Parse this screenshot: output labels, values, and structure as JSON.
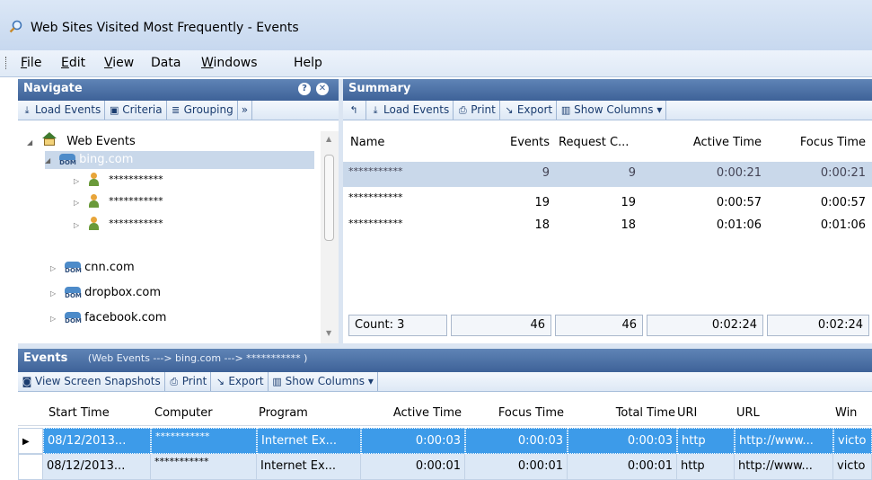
{
  "window": {
    "title": "Web Sites Visited Most Frequently - Events",
    "icon": "magnifier-icon"
  },
  "menu": [
    "File",
    "Edit",
    "View",
    "Data",
    "Windows",
    "Help"
  ],
  "navigate": {
    "title": "Navigate",
    "toolbar": [
      "Load Events",
      "Criteria",
      "Grouping",
      "»"
    ],
    "tree": {
      "root": "Web Events",
      "items": [
        {
          "label": "bing.com",
          "expanded": true,
          "children": [
            "***********",
            "***********",
            "***********"
          ]
        },
        {
          "label": "cnn.com"
        },
        {
          "label": "dropbox.com"
        },
        {
          "label": "facebook.com"
        }
      ]
    }
  },
  "summary": {
    "title": "Summary",
    "toolbar": [
      "Load Events",
      "Print",
      "Export",
      "Show Columns"
    ],
    "columns": [
      "Name",
      "Events",
      "Request C...",
      "Active Time",
      "Focus Time"
    ],
    "rows": [
      [
        "***********",
        "9",
        "9",
        "0:00:21",
        "0:00:21"
      ],
      [
        "***********",
        "19",
        "19",
        "0:00:57",
        "0:00:57"
      ],
      [
        "***********",
        "18",
        "18",
        "0:01:06",
        "0:01:06"
      ]
    ],
    "footer": [
      "Count: 3",
      "46",
      "46",
      "0:02:24",
      "0:02:24"
    ]
  },
  "events": {
    "title": "Events",
    "path": "(Web Events ---> bing.com ---> *********** )",
    "toolbar": [
      "View Screen Snapshots",
      "Print",
      "Export",
      "Show Columns"
    ],
    "columns": [
      "Start Time",
      "Computer",
      "Program",
      "Active Time",
      "Focus Time",
      "Total Time",
      "URI",
      "URL",
      "Win"
    ],
    "rows": [
      [
        "08/12/2013...",
        "***********",
        "Internet Ex...",
        "0:00:03",
        "0:00:03",
        "0:00:03",
        "http",
        "http://www...",
        "victo"
      ],
      [
        "08/12/2013...",
        "***********",
        "Internet Ex...",
        "0:00:01",
        "0:00:01",
        "0:00:01",
        "http",
        "http://www...",
        "victo"
      ]
    ]
  }
}
